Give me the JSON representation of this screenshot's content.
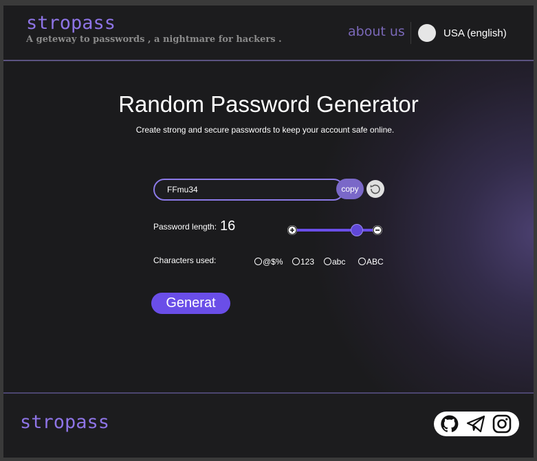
{
  "header": {
    "brand": "stropass",
    "tagline": "A geteway to passwords , a nightmare for hackers .",
    "about_label": "about us",
    "language_label": "USA (english)"
  },
  "main": {
    "title": "Random Password Generator",
    "subtitle": "Create strong and secure passwords to keep your account safe online.",
    "password_value": "FFmu34",
    "copy_label": "copy",
    "length_label": "Password length:",
    "length_value": "16",
    "length_fraction": 0.75,
    "chars_label": "Characters used:",
    "char_options": [
      {
        "label": "@$%",
        "checked": false
      },
      {
        "label": "123",
        "checked": false
      },
      {
        "label": "abc",
        "checked": false
      },
      {
        "label": "ABC",
        "checked": false
      }
    ],
    "generate_label": "Generat"
  },
  "footer": {
    "brand": "stropass",
    "socials": [
      "github-icon",
      "telegram-icon",
      "instagram-icon"
    ]
  },
  "colors": {
    "accent": "#6a4ee8",
    "brand": "#8e74e6",
    "background": "#1b1b1d"
  }
}
